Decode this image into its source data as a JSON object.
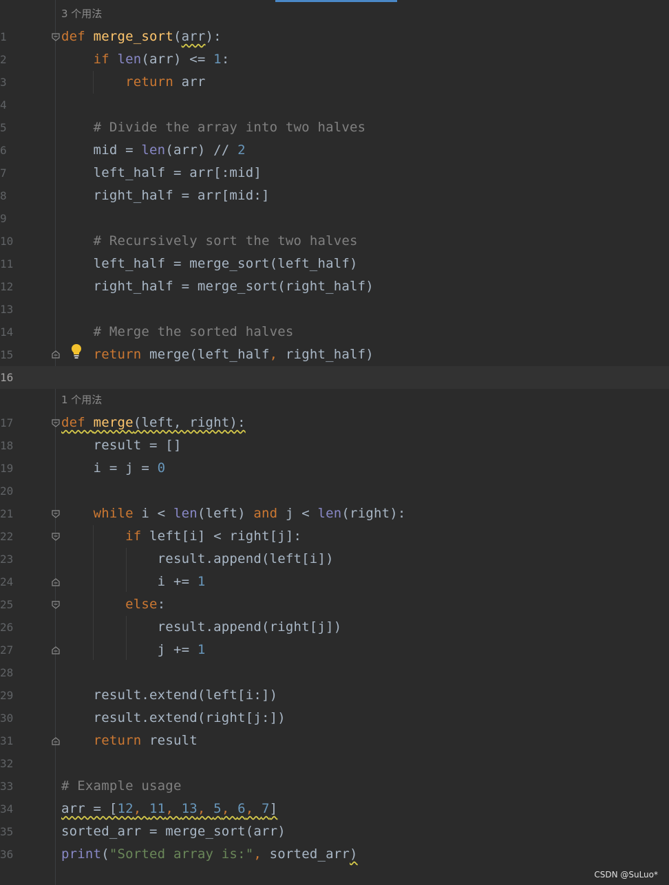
{
  "editor": {
    "usage_hints": {
      "merge_sort": "3 个用法",
      "merge": "1 个用法"
    },
    "lines": [
      {
        "n": "1",
        "tokens": [
          [
            "kw",
            "def "
          ],
          [
            "fn",
            "merge_sort"
          ],
          [
            "",
            "("
          ],
          [
            "sq",
            "arr"
          ],
          [
            "",
            "):"
          ]
        ]
      },
      {
        "n": "2",
        "tokens": [
          [
            "",
            "    "
          ],
          [
            "kw",
            "if "
          ],
          [
            "bi",
            "len"
          ],
          [
            "",
            "(arr) <= "
          ],
          [
            "num",
            "1"
          ],
          [
            "",
            ":"
          ]
        ]
      },
      {
        "n": "3",
        "tokens": [
          [
            "",
            "        "
          ],
          [
            "kw",
            "return "
          ],
          [
            "",
            "arr"
          ]
        ]
      },
      {
        "n": "4",
        "tokens": []
      },
      {
        "n": "5",
        "tokens": [
          [
            "",
            "    "
          ],
          [
            "cm",
            "# Divide the array into two halves"
          ]
        ]
      },
      {
        "n": "6",
        "tokens": [
          [
            "",
            "    mid = "
          ],
          [
            "bi",
            "len"
          ],
          [
            "",
            "(arr) // "
          ],
          [
            "num",
            "2"
          ]
        ]
      },
      {
        "n": "7",
        "tokens": [
          [
            "",
            "    left_half = arr[:mid]"
          ]
        ]
      },
      {
        "n": "8",
        "tokens": [
          [
            "",
            "    right_half = arr[mid:]"
          ]
        ]
      },
      {
        "n": "9",
        "tokens": []
      },
      {
        "n": "10",
        "tokens": [
          [
            "",
            "    "
          ],
          [
            "cm",
            "# Recursively sort the two halves"
          ]
        ]
      },
      {
        "n": "11",
        "tokens": [
          [
            "",
            "    left_half = merge_sort(left_half)"
          ]
        ]
      },
      {
        "n": "12",
        "tokens": [
          [
            "",
            "    right_half = merge_sort(right_half)"
          ]
        ]
      },
      {
        "n": "13",
        "tokens": []
      },
      {
        "n": "14",
        "tokens": [
          [
            "",
            "    "
          ],
          [
            "cm",
            "# Merge the sorted halves"
          ]
        ]
      },
      {
        "n": "15",
        "tokens": [
          [
            "",
            "    "
          ],
          [
            "kw",
            "return "
          ],
          [
            "",
            "merge(left_half"
          ],
          [
            "kw",
            ", "
          ],
          [
            "",
            "right_half)"
          ]
        ]
      },
      {
        "n": "16",
        "tokens": []
      },
      {
        "n": "17",
        "tokens": [
          [
            "sqkw",
            "def "
          ],
          [
            "sqfn",
            "merge"
          ],
          [
            "sq",
            "(left, right):"
          ]
        ]
      },
      {
        "n": "18",
        "tokens": [
          [
            "",
            "    result = []"
          ]
        ]
      },
      {
        "n": "19",
        "tokens": [
          [
            "",
            "    i = j = "
          ],
          [
            "num",
            "0"
          ]
        ]
      },
      {
        "n": "20",
        "tokens": []
      },
      {
        "n": "21",
        "tokens": [
          [
            "",
            "    "
          ],
          [
            "kw",
            "while "
          ],
          [
            "",
            "i < "
          ],
          [
            "bi",
            "len"
          ],
          [
            "",
            "(left) "
          ],
          [
            "kw",
            "and "
          ],
          [
            "",
            "j < "
          ],
          [
            "bi",
            "len"
          ],
          [
            "",
            "(right):"
          ]
        ]
      },
      {
        "n": "22",
        "tokens": [
          [
            "",
            "        "
          ],
          [
            "kw",
            "if "
          ],
          [
            "",
            "left[i] < right[j]:"
          ]
        ]
      },
      {
        "n": "23",
        "tokens": [
          [
            "",
            "            result.append(left[i])"
          ]
        ]
      },
      {
        "n": "24",
        "tokens": [
          [
            "",
            "            i += "
          ],
          [
            "num",
            "1"
          ]
        ]
      },
      {
        "n": "25",
        "tokens": [
          [
            "",
            "        "
          ],
          [
            "kw",
            "else"
          ],
          [
            "",
            ":"
          ]
        ]
      },
      {
        "n": "26",
        "tokens": [
          [
            "",
            "            result.append(right[j])"
          ]
        ]
      },
      {
        "n": "27",
        "tokens": [
          [
            "",
            "            j += "
          ],
          [
            "num",
            "1"
          ]
        ]
      },
      {
        "n": "28",
        "tokens": []
      },
      {
        "n": "29",
        "tokens": [
          [
            "",
            "    result.extend(left[i:])"
          ]
        ]
      },
      {
        "n": "30",
        "tokens": [
          [
            "",
            "    result.extend(right[j:])"
          ]
        ]
      },
      {
        "n": "31",
        "tokens": [
          [
            "",
            "    "
          ],
          [
            "kw",
            "return "
          ],
          [
            "",
            "result"
          ]
        ]
      },
      {
        "n": "32",
        "tokens": []
      },
      {
        "n": "33",
        "tokens": [
          [
            "cm",
            "# Example usage"
          ]
        ]
      },
      {
        "n": "34",
        "tokens": [
          [
            "sq",
            "arr = ["
          ],
          [
            "sqnum",
            "12"
          ],
          [
            "sqkw",
            ", "
          ],
          [
            "sqnum",
            "11"
          ],
          [
            "sqkw",
            ", "
          ],
          [
            "sqnum",
            "13"
          ],
          [
            "sqkw",
            ", "
          ],
          [
            "sqnum",
            "5"
          ],
          [
            "sqkw",
            ", "
          ],
          [
            "sqnum",
            "6"
          ],
          [
            "sqkw",
            ", "
          ],
          [
            "sqnum",
            "7"
          ],
          [
            "sq",
            "]"
          ]
        ]
      },
      {
        "n": "35",
        "tokens": [
          [
            "",
            "sorted_arr = merge_sort(arr)"
          ]
        ]
      },
      {
        "n": "36",
        "tokens": [
          [
            "bi",
            "print"
          ],
          [
            "",
            "("
          ],
          [
            "str",
            "\"Sorted array is:\""
          ],
          [
            "kw",
            ", "
          ],
          [
            "",
            "sorted_arr"
          ],
          [
            "sq",
            ")"
          ]
        ]
      }
    ]
  },
  "watermark": "CSDN @SuLuo*",
  "colors": {
    "background": "#2b2b2b",
    "keyword": "#cc7832",
    "function": "#ffc66d",
    "builtin": "#8888c6",
    "number": "#6897bb",
    "comment": "#808080",
    "string": "#6a8759",
    "text": "#a9b7c6"
  }
}
